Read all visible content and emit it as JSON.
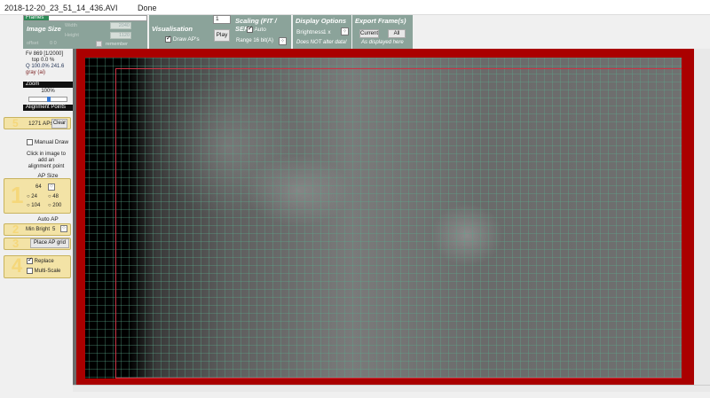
{
  "titlebar": {
    "filename": "2018-12-20_23_51_14_436.AVI",
    "status": "Done"
  },
  "frames": {
    "label": "Frames",
    "progress": 0.2
  },
  "image_size": {
    "title": "Image Size",
    "width_label": "Width",
    "width_value": "2040",
    "height_label": "Height",
    "height_value": "1120",
    "offset_label": "offset",
    "offset_values": "0   0",
    "remember_label": "remember"
  },
  "visualisation": {
    "title": "Visualisation",
    "draw_aps_label": "Draw AP's",
    "frame_input": "1",
    "play_label": "Play"
  },
  "scaling": {
    "title": "Scaling (FIT / SER)",
    "auto_label": "Auto",
    "range_label": "Range 16 bit(A)"
  },
  "display": {
    "title": "Display Options",
    "brightness_label": "Brightness",
    "brightness_value": "1 x",
    "note": "Does NOT alter data!"
  },
  "export": {
    "title": "Export Frame(s)",
    "current_label": "Current",
    "all_label": "All",
    "note": "As displayed here"
  },
  "info": {
    "frame": "F# 869 [1/2000]",
    "top": "top 0.0 %",
    "quality": "Q 100.0%  241.6",
    "gray": "gray (ai)"
  },
  "zoom": {
    "label": "Zoom",
    "value": "100%",
    "slider": 0.5
  },
  "alignment": {
    "header": "Alignment Points",
    "count_label": "1271 APs",
    "clear_label": "Clear",
    "manual_draw_label": "Manual Draw",
    "hint": "Click in image to add an alignment point",
    "ap_size_label": "AP Size",
    "ap_sizes": [
      "64",
      "24",
      "48",
      "104",
      "200"
    ],
    "auto_ap_label": "Auto AP",
    "min_bright_label": "Min Bright",
    "min_bright_value": "5",
    "place_grid_label": "Place AP grid",
    "replace_label": "Replace",
    "multiscale_label": "Multi-Scale"
  },
  "step_numbers": [
    "5",
    "1",
    "2",
    "3",
    "4"
  ],
  "colors": {
    "panel": "#8ba39a",
    "highlight": "#f3e3a6",
    "roi": "#cc3344",
    "frame": "#aa0000",
    "grid": "#5aaa8c"
  }
}
